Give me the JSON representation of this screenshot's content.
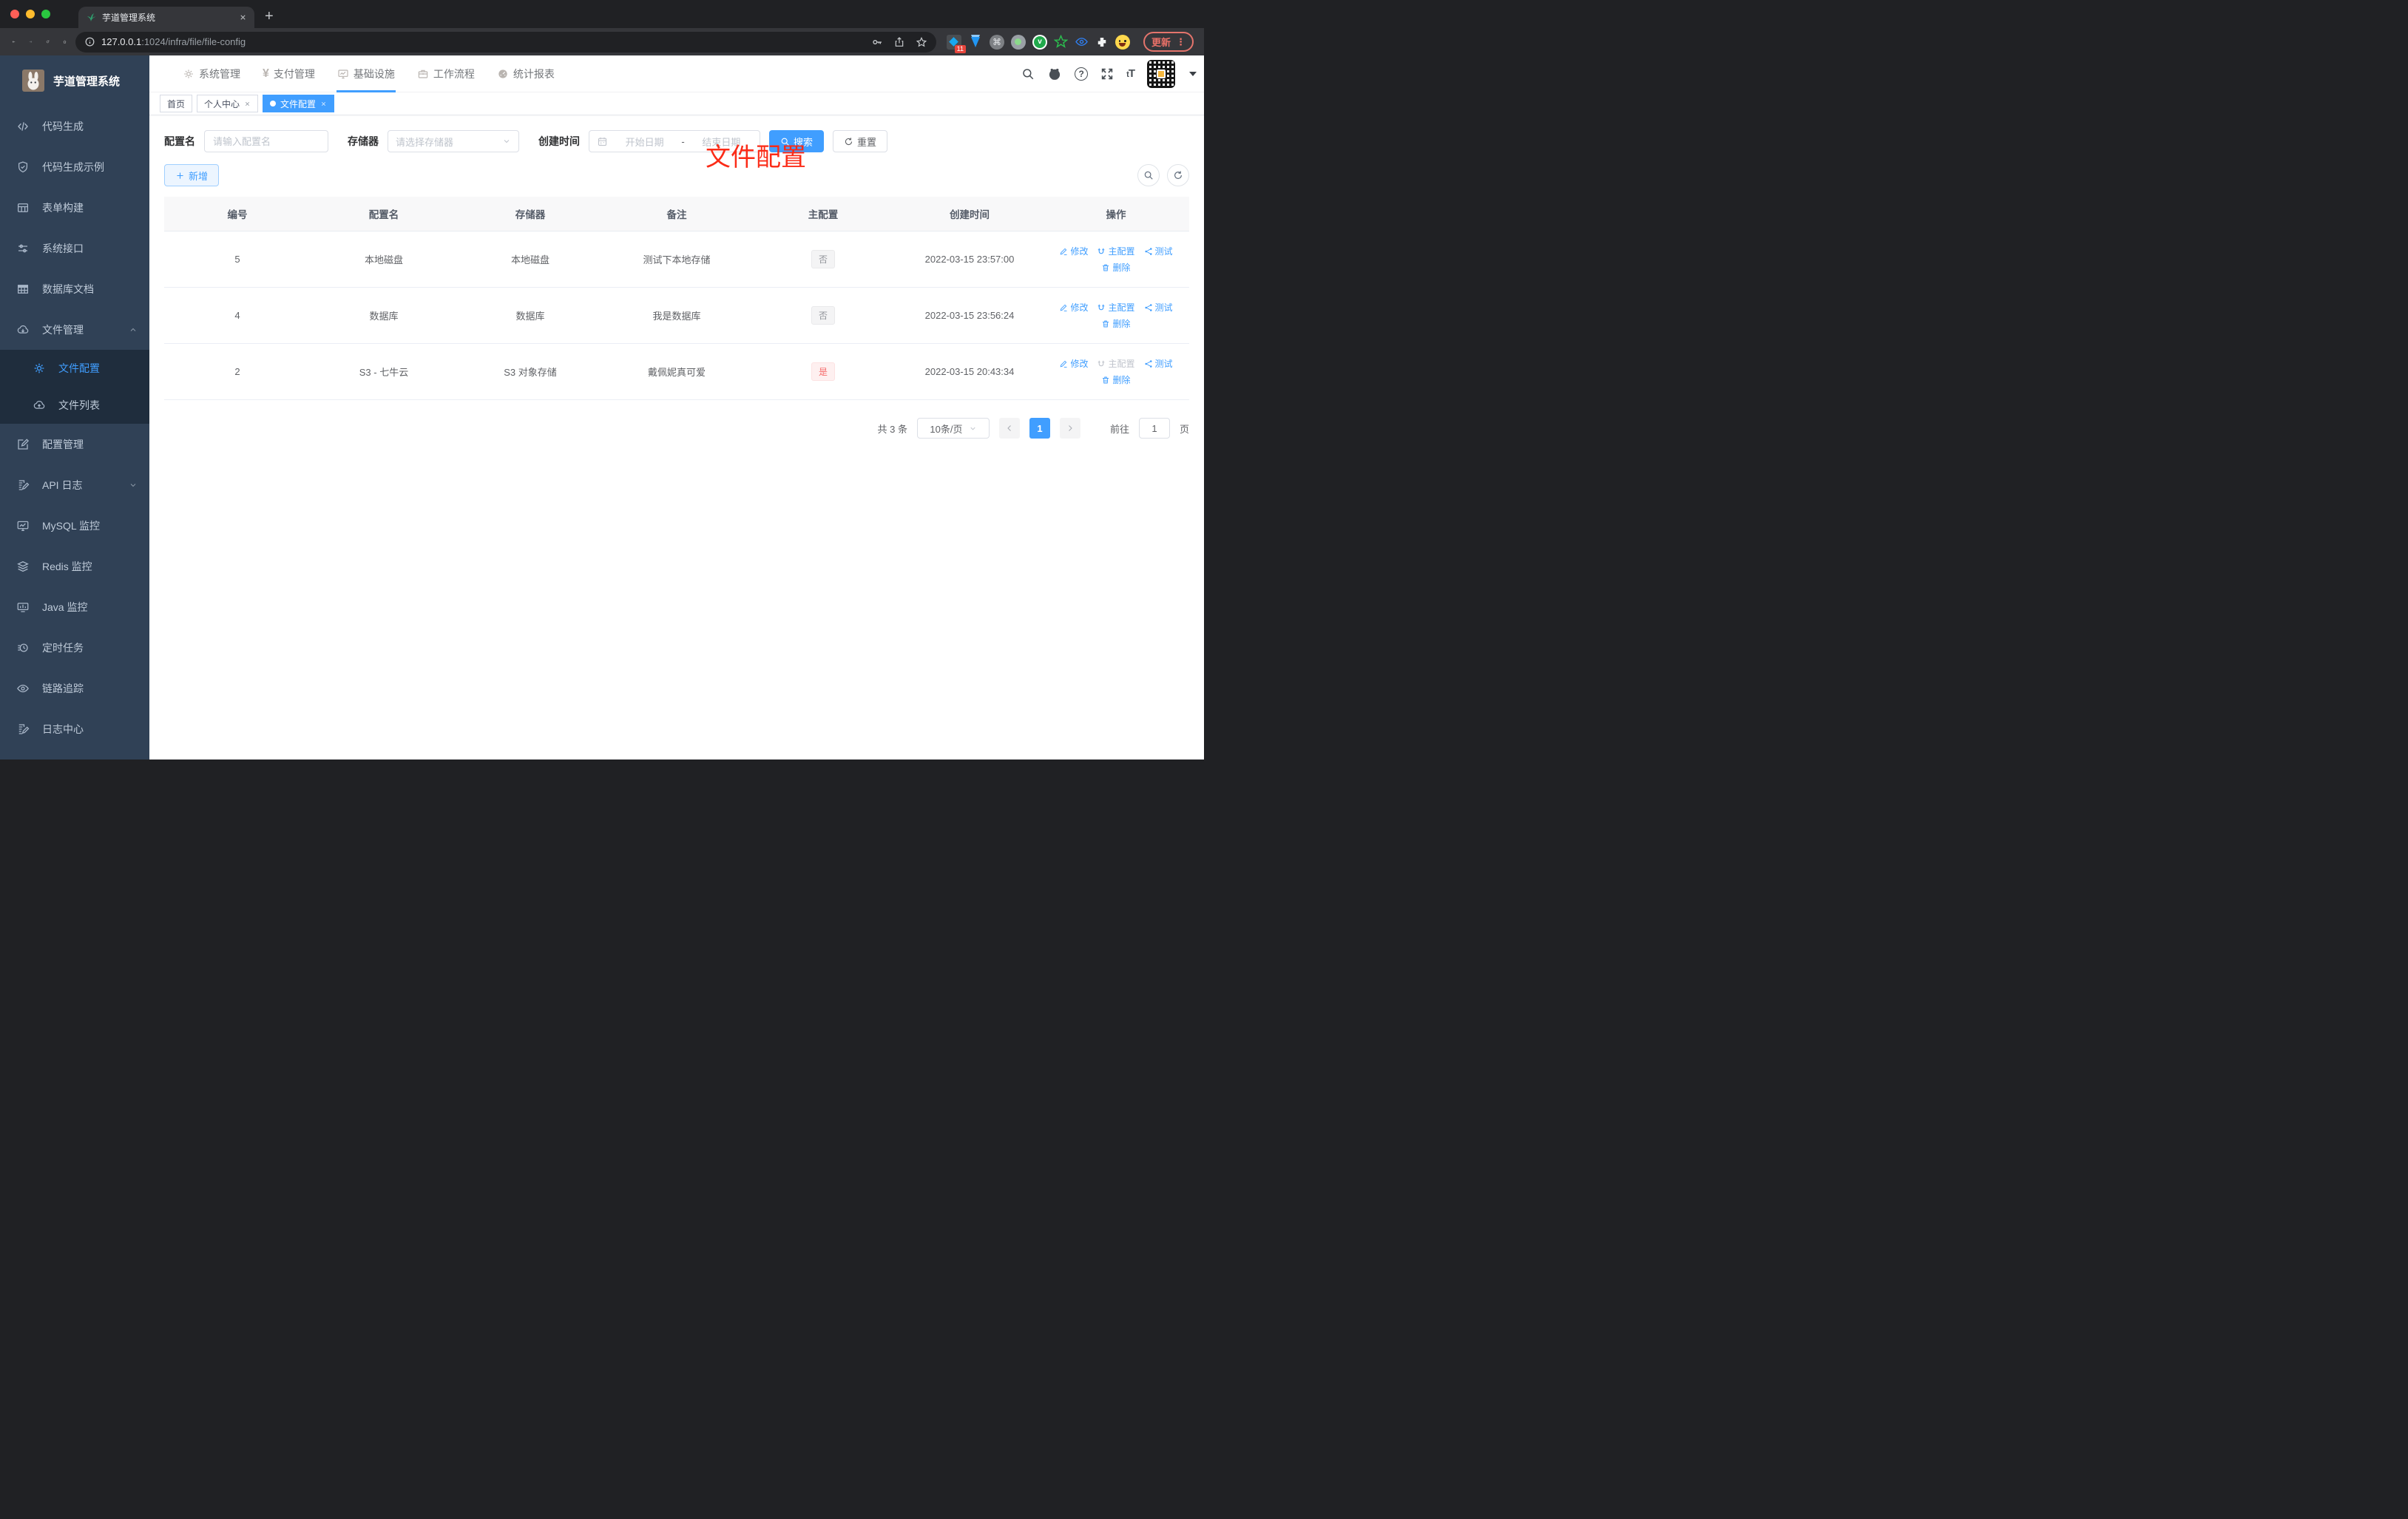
{
  "browser": {
    "tab_title": "芋道管理系统",
    "url_host": "127.0.0.1",
    "url_rest": ":1024/infra/file/file-config",
    "ext_badge": "11",
    "update_label": "更新",
    "update_menu_dots": "⋮"
  },
  "sidebar": {
    "logo_title": "芋道管理系统",
    "items": [
      {
        "label": "代码生成"
      },
      {
        "label": "代码生成示例"
      },
      {
        "label": "表单构建"
      },
      {
        "label": "系统接口"
      },
      {
        "label": "数据库文档"
      },
      {
        "label": "文件管理"
      },
      {
        "label": "文件配置"
      },
      {
        "label": "文件列表"
      },
      {
        "label": "配置管理"
      },
      {
        "label": "API 日志"
      },
      {
        "label": "MySQL 监控"
      },
      {
        "label": "Redis 监控"
      },
      {
        "label": "Java 监控"
      },
      {
        "label": "定时任务"
      },
      {
        "label": "链路追踪"
      },
      {
        "label": "日志中心"
      }
    ]
  },
  "topnav": {
    "items": [
      {
        "label": "系统管理"
      },
      {
        "label": "支付管理"
      },
      {
        "label": "基础设施",
        "active": true
      },
      {
        "label": "工作流程"
      },
      {
        "label": "统计报表"
      }
    ],
    "yen_glyph": "¥",
    "font_size_glyph": "tT"
  },
  "tags": [
    {
      "label": "首页",
      "closable": false
    },
    {
      "label": "个人中心",
      "closable": true
    },
    {
      "label": "文件配置",
      "closable": true,
      "active": true
    }
  ],
  "annotation": {
    "text": "文件配置"
  },
  "filter": {
    "config_name_label": "配置名",
    "config_name_placeholder": "请输入配置名",
    "storage_label": "存储器",
    "storage_placeholder": "请选择存储器",
    "create_time_label": "创建时间",
    "date_start_placeholder": "开始日期",
    "date_separator": "-",
    "date_end_placeholder": "结束日期",
    "search_label": "搜索",
    "reset_label": "重置"
  },
  "toolbar": {
    "add_label": "新增"
  },
  "table": {
    "headers": [
      "编号",
      "配置名",
      "存储器",
      "备注",
      "主配置",
      "创建时间",
      "操作"
    ],
    "rows": [
      {
        "id": "5",
        "name": "本地磁盘",
        "storage": "本地磁盘",
        "remark": "测试下本地存储",
        "master": "否",
        "master_type": "info",
        "created": "2022-03-15 23:57:00"
      },
      {
        "id": "4",
        "name": "数据库",
        "storage": "数据库",
        "remark": "我是数据库",
        "master": "否",
        "master_type": "info",
        "created": "2022-03-15 23:56:24"
      },
      {
        "id": "2",
        "name": "S3 - 七牛云",
        "storage": "S3 对象存储",
        "remark": "戴佩妮真可爱",
        "master": "是",
        "master_type": "danger",
        "created": "2022-03-15 20:43:34"
      }
    ],
    "actions": {
      "edit": "修改",
      "master": "主配置",
      "test": "测试",
      "delete": "删除"
    }
  },
  "pagination": {
    "total": "共 3 条",
    "page_size": "10条/页",
    "current_page": "1",
    "goto_label": "前往",
    "goto_value": "1",
    "page_unit": "页"
  },
  "colors": {
    "primary": "#409eff",
    "sidebar_bg": "#304156",
    "submenu_bg": "#1f2d3d",
    "tag_info_text": "#909399",
    "tag_danger_text": "#f56c6c",
    "annotation_red": "#fb2b17"
  }
}
